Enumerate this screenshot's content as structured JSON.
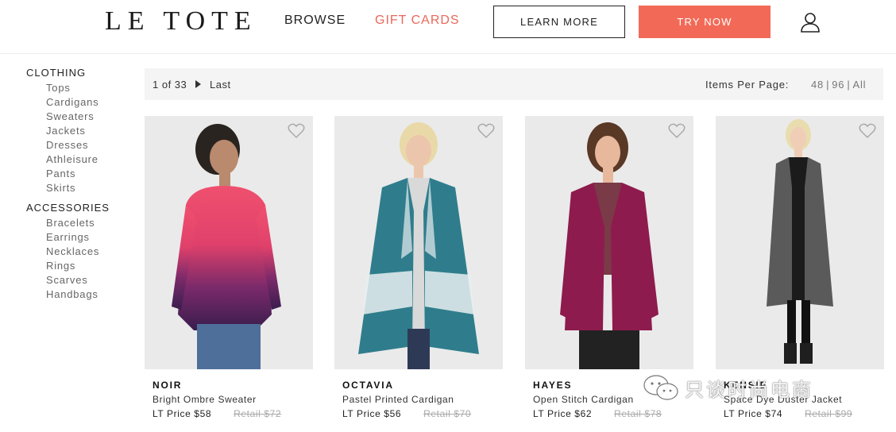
{
  "header": {
    "logo": "LE TOTE",
    "nav": {
      "browse": "BROWSE",
      "gift_cards": "GIFT CARDS"
    },
    "learn_more": "LEARN MORE",
    "try_now": "TRY NOW",
    "icons": {
      "user": "user-icon"
    },
    "colors": {
      "accent": "#f26a57",
      "gift": "#e86a5b"
    }
  },
  "sidebar": {
    "clothing": {
      "heading": "CLOTHING",
      "items": [
        "Tops",
        "Cardigans",
        "Sweaters",
        "Jackets",
        "Dresses",
        "Athleisure",
        "Pants",
        "Skirts"
      ]
    },
    "accessories": {
      "heading": "ACCESSORIES",
      "items": [
        "Bracelets",
        "Earrings",
        "Necklaces",
        "Rings",
        "Scarves",
        "Handbags"
      ]
    }
  },
  "pager": {
    "count": "1 of 33",
    "last": "Last",
    "items_per_page_label": "Items Per Page:",
    "options": [
      "48",
      "96",
      "All"
    ]
  },
  "products": [
    {
      "name": "NOIR",
      "desc": "Bright Ombre Sweater",
      "price": "LT Price $58",
      "retail": "Retail $72",
      "garment_color": "#e0416b"
    },
    {
      "name": "OCTAVIA",
      "desc": "Pastel Printed Cardigan",
      "price": "LT Price $56",
      "retail": "Retail $70",
      "garment_color": "#2f7d8c"
    },
    {
      "name": "HAYES",
      "desc": "Open Stitch Cardigan",
      "price": "LT Price $62",
      "retail": "Retail $78",
      "garment_color": "#8e1b4e"
    },
    {
      "name": "KENSIE",
      "desc": "Space Dye Duster Jacket",
      "price": "LT Price $74",
      "retail": "Retail $99",
      "garment_color": "#5a5a5a"
    }
  ],
  "watermark": {
    "text": "只谈时尚电商"
  }
}
